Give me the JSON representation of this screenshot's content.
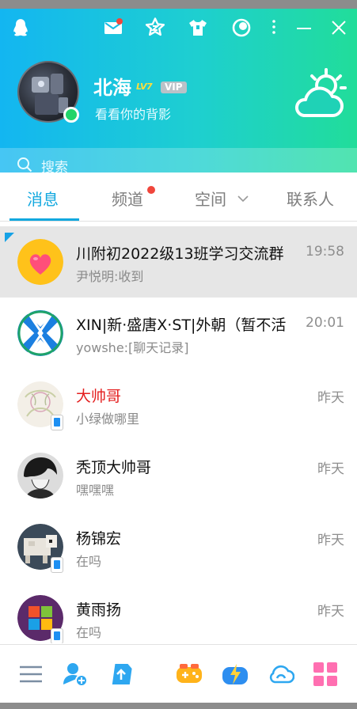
{
  "profile": {
    "nickname": "北海",
    "level_badge": "LV7",
    "vip_badge": "VIP",
    "signature": "看看你的背影"
  },
  "search": {
    "placeholder": "搜索"
  },
  "tabs": [
    {
      "label": "消息",
      "active": true
    },
    {
      "label": "频道",
      "has_dot": true
    },
    {
      "label": "空间",
      "has_dropdown": true
    },
    {
      "label": "联系人"
    }
  ],
  "conversations": [
    {
      "name": "川附初2022级13班学习交流群",
      "message": "尹悦明:收到",
      "time": "19:58",
      "selected": true
    },
    {
      "name": "XIN|新·盛唐X·ST|外朝（暂不活",
      "message": "yowshe:[聊天记录]",
      "time": "20:01"
    },
    {
      "name": "大帅哥",
      "message": "小绿做哪里",
      "time": "昨天",
      "name_color": "#e41f1f"
    },
    {
      "name": "秃顶大帅哥",
      "message": "嘿嘿嘿",
      "time": "昨天"
    },
    {
      "name": "杨锦宏",
      "message": "在吗",
      "time": "昨天"
    },
    {
      "name": "黄雨扬",
      "message": "在吗",
      "time": "昨天"
    }
  ],
  "colors": {
    "accent": "#12a8df",
    "header_gradient_start": "#13b6f1",
    "header_gradient_end": "#21dd9a",
    "notification_dot": "#f0463c"
  }
}
